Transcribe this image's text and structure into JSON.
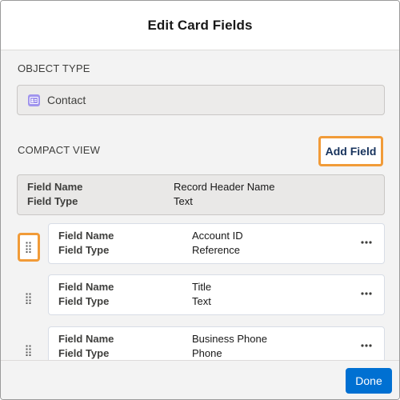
{
  "modal": {
    "title": "Edit Card Fields"
  },
  "object_type": {
    "section_label": "OBJECT TYPE",
    "value": "Contact",
    "icon": "contact-icon",
    "icon_color": "#a094ed"
  },
  "compact_view": {
    "section_label": "COMPACT VIEW",
    "add_field_label": "Add Field",
    "header_field": {
      "name_label": "Field Name",
      "name_value": "Record Header Name",
      "type_label": "Field Type",
      "type_value": "Text"
    },
    "fields": [
      {
        "name_label": "Field Name",
        "name_value": "Account ID",
        "type_label": "Field Type",
        "type_value": "Reference"
      },
      {
        "name_label": "Field Name",
        "name_value": "Title",
        "type_label": "Field Type",
        "type_value": "Text"
      },
      {
        "name_label": "Field Name",
        "name_value": "Business Phone",
        "type_label": "Field Type",
        "type_value": "Phone"
      }
    ]
  },
  "footer": {
    "done_label": "Done"
  },
  "colors": {
    "highlight": "#f19b38",
    "brand": "#0070d2",
    "add_field_text": "#16325c"
  }
}
